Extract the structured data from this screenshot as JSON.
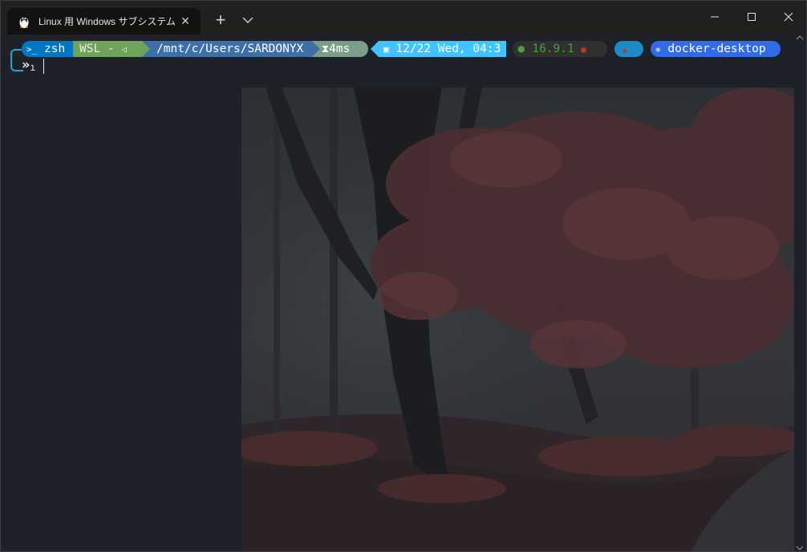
{
  "tab": {
    "title": "Linux 用 Windows サブシステム プレビュー",
    "close_glyph": "✕",
    "icon": "tux-linux-icon"
  },
  "titlebar": {
    "new_tab_glyph": "+",
    "dropdown_icon": "chevron-down-icon",
    "minimize_icon": "minimize-icon",
    "maximize_icon": "maximize-icon",
    "close_icon": "close-icon"
  },
  "prompt": {
    "shell": "zsh",
    "shell_icon": "terminal-icon",
    "os": "WSL - ",
    "os_icon": "windows-speaker-icon",
    "path": "/mnt/c/Users/SARDONYX",
    "duration": "4ms",
    "duration_icon": "hourglass-icon",
    "datetime": "12/22 Wed, 04:3",
    "datetime_icon": "calendar-icon",
    "node_version": "16.9.1",
    "node_icon": "nodejs-icon",
    "folder_icon": "folder-icon",
    "extra_icon": "ruby-icon",
    "kube_context": "docker-desktop",
    "kube_icon": "kubernetes-icon",
    "second_line": "»"
  },
  "colors": {
    "shell_bg": "#0077c2",
    "os_bg": "#6fa35a",
    "path_bg": "#3e6fa6",
    "duration_bg": "#7a9e88",
    "datetime_bg": "#40c4ff",
    "node_bg": "#303030",
    "node_fg": "#4a9e3f",
    "extra_bg": "#1d8bc8",
    "kube_bg": "#316ce6",
    "background": "#1e2228"
  }
}
